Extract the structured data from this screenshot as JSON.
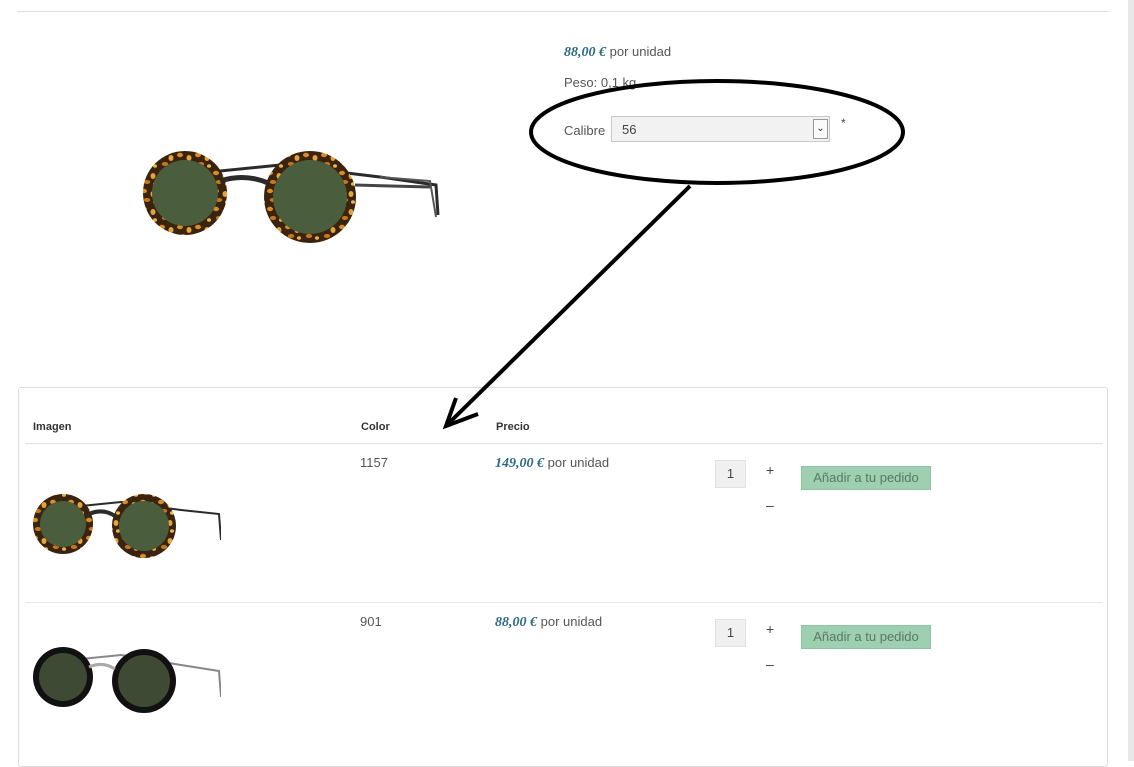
{
  "product": {
    "price_amount": "88,00 €",
    "price_unit": "por unidad",
    "weight": "Peso: 0,1 kg",
    "image_icon": "tortoise-round-sunglasses"
  },
  "calibre": {
    "label": "Calibre",
    "selected": "56",
    "required_mark": "*"
  },
  "table": {
    "headers": {
      "image": "Imagen",
      "color": "Color",
      "price": "Precio"
    },
    "rows": [
      {
        "color": "1157",
        "price_amount": "149,00 €",
        "price_unit": "por unidad",
        "quantity": "1",
        "plus": "+",
        "minus": "–",
        "add_label": "Añadir a tu pedido",
        "image_icon": "tortoise-round-sunglasses"
      },
      {
        "color": "901",
        "price_amount": "88,00 €",
        "price_unit": "por unidad",
        "quantity": "1",
        "plus": "+",
        "minus": "–",
        "add_label": "Añadir a tu pedido",
        "image_icon": "black-round-sunglasses"
      }
    ]
  },
  "colors": {
    "price": "#2c6a86",
    "add_button": "#9dcfb0",
    "annotation": "#000000"
  }
}
